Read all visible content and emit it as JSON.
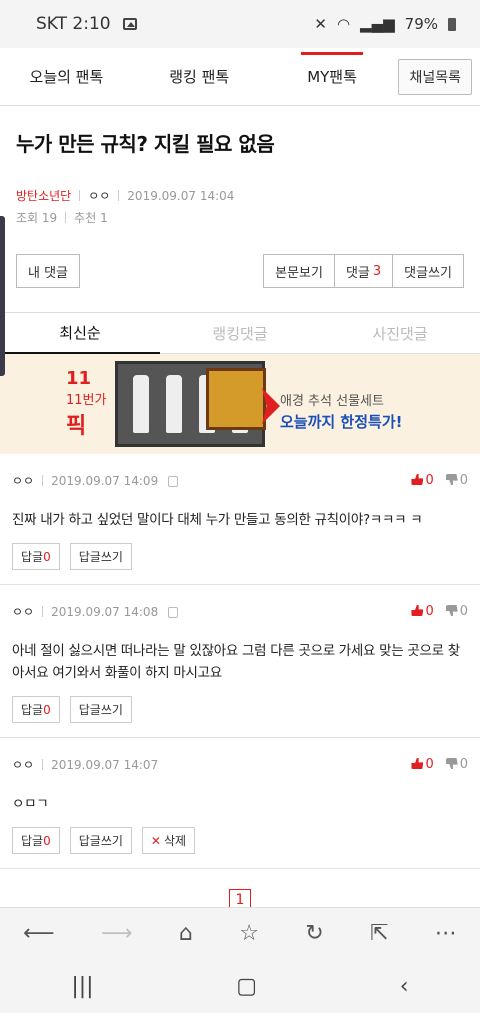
{
  "status": {
    "carrier_time": "SKT 2:10",
    "battery": "79%"
  },
  "topnav": {
    "tabs": [
      "오늘의 팬톡",
      "랭킹 팬톡",
      "MY팬톡"
    ],
    "channel_button": "채널목록"
  },
  "post": {
    "title": "누가 만든 규칙? 지킬 필요 없음",
    "category": "방탄소년단",
    "author": "ㅇㅇ",
    "date": "2019.09.07 14:04",
    "views": "조회 19",
    "likes": "추천 1"
  },
  "buttons": {
    "my_comments": "내 댓글",
    "view_post": "본문보기",
    "comments_label": "댓글",
    "comments_count": "3",
    "write_comment": "댓글쓰기"
  },
  "comment_tabs": [
    "최신순",
    "랭킹댓글",
    "사진댓글"
  ],
  "banner": {
    "brand_logo": "11",
    "brand_name": "11번가",
    "brand_pick": "픽",
    "line1": "애경 추석 선물세트",
    "line2": "오늘까지 한정특가!"
  },
  "comments": [
    {
      "nick": "ㅇㅇ",
      "date": "2019.09.07 14:09",
      "up": "0",
      "down": "0",
      "body": "진짜 내가 하고 싶었던 말이다 대체 누가 만들고 동의한 규칙이야?ㅋㅋㅋ ㅋ",
      "reply_label": "답글",
      "reply_count": "0",
      "reply_write": "답글쓰기"
    },
    {
      "nick": "ㅇㅇ",
      "date": "2019.09.07 14:08",
      "up": "0",
      "down": "0",
      "body": "아네 절이 싫으시면 떠나라는 말 있잖아요 그럼 다른 곳으로 가세요 맞는 곳으로 찾아서요 여기와서 화풀이 하지 마시고요",
      "reply_label": "답글",
      "reply_count": "0",
      "reply_write": "답글쓰기"
    },
    {
      "nick": "ㅇㅇ",
      "date": "2019.09.07 14:07",
      "up": "0",
      "down": "0",
      "body": "ㅇㅁㄱ",
      "reply_label": "답글",
      "reply_count": "0",
      "reply_write": "답글쓰기",
      "delete": "삭제"
    }
  ],
  "pagination": {
    "current": "1"
  },
  "browser_icons": [
    "back-icon",
    "forward-icon",
    "home-icon",
    "star-icon",
    "refresh-icon",
    "share-icon",
    "more-icon"
  ],
  "colors": {
    "accent": "#e02020",
    "banner_bg": "#fbf1e0",
    "banner_text": "#1b4fb8"
  }
}
